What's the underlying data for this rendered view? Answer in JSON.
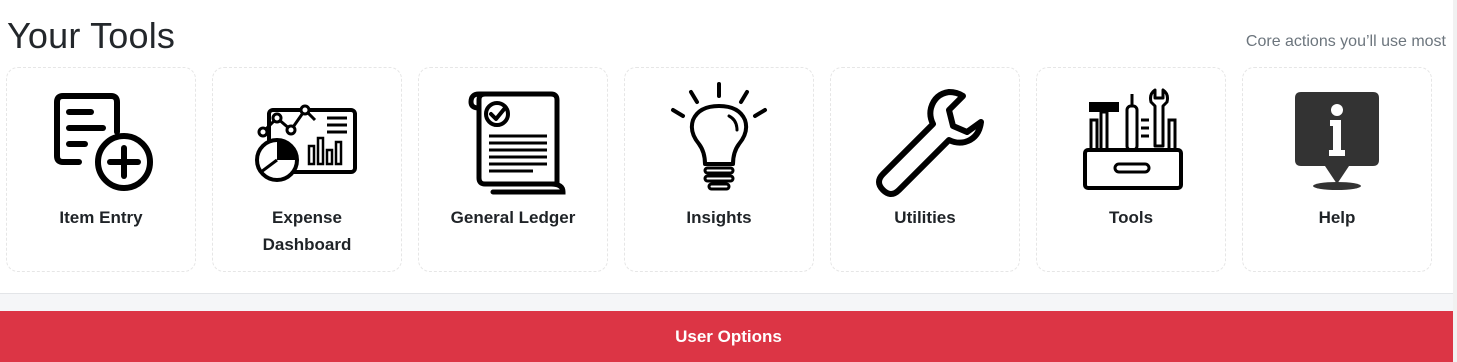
{
  "header": {
    "title": "Your Tools",
    "subtitle": "Core actions you’ll use most"
  },
  "tools": [
    {
      "label": "Item Entry",
      "icon": "document-add-icon"
    },
    {
      "label": "Expense Dashboard",
      "icon": "dashboard-chart-icon"
    },
    {
      "label": "General Ledger",
      "icon": "ledger-scroll-icon"
    },
    {
      "label": "Insights",
      "icon": "lightbulb-icon"
    },
    {
      "label": "Utilities",
      "icon": "wrench-icon"
    },
    {
      "label": "Tools",
      "icon": "toolbox-icon"
    },
    {
      "label": "Help",
      "icon": "info-pin-icon"
    }
  ],
  "footer": {
    "button_label": "User Options"
  },
  "colors": {
    "accent": "#dc3545",
    "text": "#1f2327",
    "muted": "#6c757d"
  }
}
